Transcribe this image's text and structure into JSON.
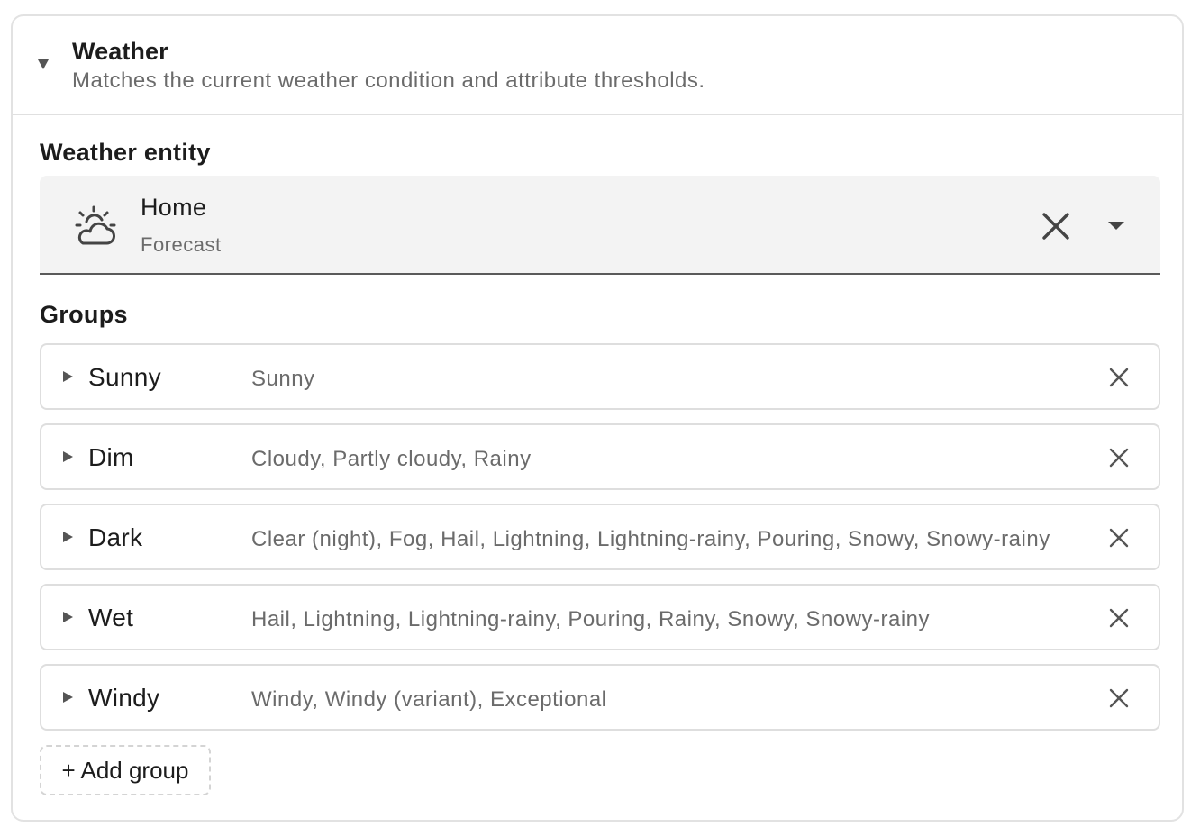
{
  "card": {
    "title": "Weather",
    "description": "Matches the current weather condition and attribute thresholds."
  },
  "entity": {
    "label": "Weather entity",
    "name": "Home",
    "subtitle": "Forecast",
    "icon": "weather-partly-cloudy-icon"
  },
  "groups": {
    "label": "Groups",
    "items": [
      {
        "name": "Sunny",
        "conditions": "Sunny"
      },
      {
        "name": "Dim",
        "conditions": "Cloudy, Partly cloudy, Rainy"
      },
      {
        "name": "Dark",
        "conditions": "Clear (night), Fog, Hail, Lightning, Lightning-rainy, Pouring, Snowy, Snowy-rainy"
      },
      {
        "name": "Wet",
        "conditions": "Hail, Lightning, Lightning-rainy, Pouring, Rainy, Snowy, Snowy-rainy"
      },
      {
        "name": "Windy",
        "conditions": "Windy, Windy (variant), Exceptional"
      }
    ],
    "add_label": "+ Add group"
  },
  "colors": {
    "text_primary": "#1c1c1c",
    "text_secondary": "#6b6b6b",
    "border": "#dedede",
    "field_background": "#f3f3f3"
  }
}
